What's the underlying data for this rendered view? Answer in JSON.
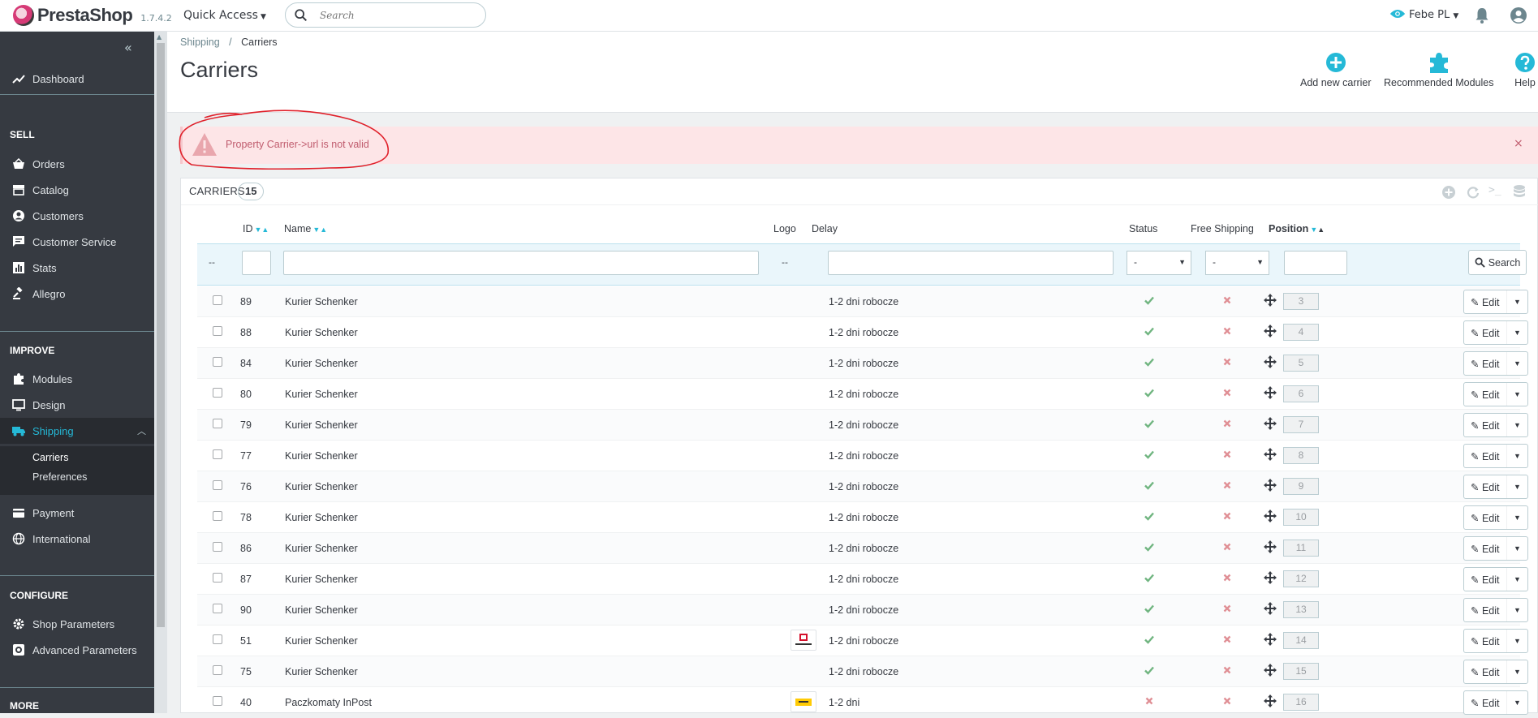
{
  "header": {
    "brand": "PrestaShop",
    "version": "1.7.4.2",
    "quick_access": "Quick Access",
    "search_placeholder": "Search",
    "shop_name": "Febe PL"
  },
  "sidebar": {
    "top_items": [
      {
        "label": "Dashboard",
        "icon": "trending-up-icon"
      }
    ],
    "sections": [
      {
        "title": "SELL",
        "items": [
          {
            "label": "Orders",
            "icon": "basket-icon"
          },
          {
            "label": "Catalog",
            "icon": "store-icon"
          },
          {
            "label": "Customers",
            "icon": "account-icon"
          },
          {
            "label": "Customer Service",
            "icon": "chat-icon"
          },
          {
            "label": "Stats",
            "icon": "bar-chart-icon"
          },
          {
            "label": "Allegro",
            "icon": "gavel-icon"
          }
        ]
      },
      {
        "title": "IMPROVE",
        "items": [
          {
            "label": "Modules",
            "icon": "puzzle-icon"
          },
          {
            "label": "Design",
            "icon": "monitor-icon"
          },
          {
            "label": "Shipping",
            "icon": "truck-icon",
            "active": true
          },
          {
            "label": "Payment",
            "icon": "card-icon"
          },
          {
            "label": "International",
            "icon": "globe-icon"
          }
        ]
      },
      {
        "title": "CONFIGURE",
        "items": [
          {
            "label": "Shop Parameters",
            "icon": "settings-icon"
          },
          {
            "label": "Advanced Parameters",
            "icon": "settings-box-icon"
          }
        ]
      },
      {
        "title": "MORE",
        "items": []
      }
    ],
    "shipping_sub": [
      "Carriers",
      "Preferences"
    ]
  },
  "page": {
    "breadcrumb": [
      "Shipping",
      "Carriers"
    ],
    "title": "Carriers",
    "toolbar": [
      {
        "label": "Add new carrier",
        "icon": "add-circle-icon"
      },
      {
        "label": "Recommended Modules",
        "icon": "puzzle-icon"
      },
      {
        "label": "Help",
        "icon": "help-icon"
      }
    ]
  },
  "alert": {
    "message": "Property Carrier->url is not valid"
  },
  "panel": {
    "title": "Carriers",
    "count": "15",
    "columns": {
      "id": "ID",
      "name": "Name",
      "logo": "Logo",
      "delay": "Delay",
      "status": "Status",
      "free_shipping": "Free Shipping",
      "position": "Position"
    },
    "filter": {
      "dash": "--",
      "logo_dash": "--",
      "status_select": "-",
      "free_select": "-",
      "search_button": "Search"
    },
    "edit_label": "Edit",
    "rows": [
      {
        "id": "89",
        "name": "Kurier Schenker",
        "logo": "",
        "delay": "1-2 dni robocze",
        "status": true,
        "free": false,
        "position": "3"
      },
      {
        "id": "88",
        "name": "Kurier Schenker",
        "logo": "",
        "delay": "1-2 dni robocze",
        "status": true,
        "free": false,
        "position": "4"
      },
      {
        "id": "84",
        "name": "Kurier Schenker",
        "logo": "",
        "delay": "1-2 dni robocze",
        "status": true,
        "free": false,
        "position": "5"
      },
      {
        "id": "80",
        "name": "Kurier Schenker",
        "logo": "",
        "delay": "1-2 dni robocze",
        "status": true,
        "free": false,
        "position": "6"
      },
      {
        "id": "79",
        "name": "Kurier Schenker",
        "logo": "",
        "delay": "1-2 dni robocze",
        "status": true,
        "free": false,
        "position": "7"
      },
      {
        "id": "77",
        "name": "Kurier Schenker",
        "logo": "",
        "delay": "1-2 dni robocze",
        "status": true,
        "free": false,
        "position": "8"
      },
      {
        "id": "76",
        "name": "Kurier Schenker",
        "logo": "",
        "delay": "1-2 dni robocze",
        "status": true,
        "free": false,
        "position": "9"
      },
      {
        "id": "78",
        "name": "Kurier Schenker",
        "logo": "",
        "delay": "1-2 dni robocze",
        "status": true,
        "free": false,
        "position": "10"
      },
      {
        "id": "86",
        "name": "Kurier Schenker",
        "logo": "",
        "delay": "1-2 dni robocze",
        "status": true,
        "free": false,
        "position": "11"
      },
      {
        "id": "87",
        "name": "Kurier Schenker",
        "logo": "",
        "delay": "1-2 dni robocze",
        "status": true,
        "free": false,
        "position": "12"
      },
      {
        "id": "90",
        "name": "Kurier Schenker",
        "logo": "",
        "delay": "1-2 dni robocze",
        "status": true,
        "free": false,
        "position": "13"
      },
      {
        "id": "51",
        "name": "Kurier Schenker",
        "logo": "schenker",
        "delay": "1-2 dni robocze",
        "status": true,
        "free": false,
        "position": "14"
      },
      {
        "id": "75",
        "name": "Kurier Schenker",
        "logo": "",
        "delay": "1-2 dni robocze",
        "status": true,
        "free": false,
        "position": "15"
      },
      {
        "id": "40",
        "name": "Paczkomaty InPost",
        "logo": "inpost",
        "delay": "1-2 dni",
        "status": false,
        "free": false,
        "position": "16"
      }
    ]
  },
  "colors": {
    "accent": "#25b9d7",
    "success": "#70b580",
    "danger": "#e08f95",
    "sidebar": "#363a41",
    "alert_bg": "#fde5e7",
    "annotation": "#e0202a"
  }
}
